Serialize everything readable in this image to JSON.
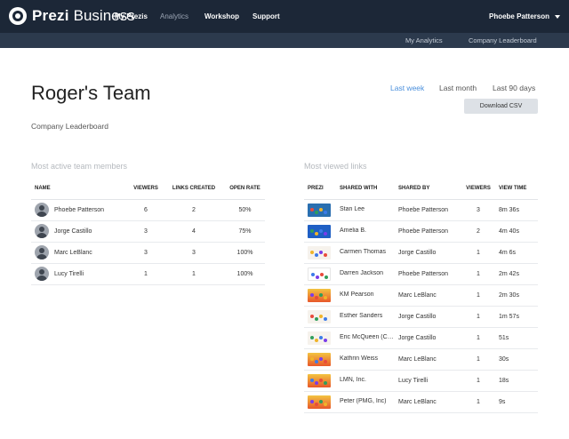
{
  "brand": {
    "name": "Prezi",
    "suffix": "Business"
  },
  "nav": {
    "my_prezis": "My Prezis",
    "analytics": "Analytics",
    "workshop": "Workshop",
    "support": "Support",
    "user": "Phoebe Patterson"
  },
  "subnav": {
    "my_analytics": "My Analytics",
    "leaderboard": "Company Leaderboard"
  },
  "header": {
    "title": "Roger's Team",
    "subtitle": "Company Leaderboard",
    "ranges": [
      "Last week",
      "Last month",
      "Last 90 days"
    ],
    "download": "Download CSV"
  },
  "members": {
    "title": "Most active team members",
    "columns": [
      "NAME",
      "VIEWERS",
      "LINKS CREATED",
      "OPEN RATE"
    ],
    "rows": [
      {
        "name": "Phoebe Patterson",
        "viewers": "6",
        "links": "2",
        "rate": "50%"
      },
      {
        "name": "Jorge Castillo",
        "viewers": "3",
        "links": "4",
        "rate": "75%"
      },
      {
        "name": "Marc LeBlanc",
        "viewers": "3",
        "links": "3",
        "rate": "100%"
      },
      {
        "name": "Lucy Tirelli",
        "viewers": "1",
        "links": "1",
        "rate": "100%"
      }
    ]
  },
  "viewed": {
    "title": "Most viewed links",
    "columns": [
      "PREZI",
      "SHARED WITH",
      "SHARED BY",
      "VIEWERS",
      "VIEW TIME"
    ],
    "rows": [
      {
        "thumb": "thumb-a",
        "with": "Stan Lee",
        "by": "Phoebe Patterson",
        "viewers": "3",
        "time": "8m 36s"
      },
      {
        "thumb": "thumb-b",
        "with": "Amelia B.",
        "by": "Phoebe Patterson",
        "viewers": "2",
        "time": "4m 40s"
      },
      {
        "thumb": "thumb-c",
        "with": "Carmen Thomas",
        "by": "Jorge Castillo",
        "viewers": "1",
        "time": "4m 6s"
      },
      {
        "thumb": "thumb-d",
        "with": "Darren Jackson",
        "by": "Phoebe Patterson",
        "viewers": "1",
        "time": "2m 42s"
      },
      {
        "thumb": "thumb-e",
        "with": "KM Pearson",
        "by": "Marc LeBlanc",
        "viewers": "1",
        "time": "2m 30s"
      },
      {
        "thumb": "thumb-c",
        "with": "Esther Sanders",
        "by": "Jorge Castillo",
        "viewers": "1",
        "time": "1m 57s"
      },
      {
        "thumb": "thumb-c",
        "with": "Eric McQueen (CM...",
        "by": "Jorge Castillo",
        "viewers": "1",
        "time": "51s"
      },
      {
        "thumb": "thumb-e",
        "with": "Kathrin Weiss",
        "by": "Marc LeBlanc",
        "viewers": "1",
        "time": "30s"
      },
      {
        "thumb": "thumb-e",
        "with": "LMN, Inc.",
        "by": "Lucy Tirelli",
        "viewers": "1",
        "time": "18s"
      },
      {
        "thumb": "thumb-e",
        "with": "Peter (PMG, Inc)",
        "by": "Marc LeBlanc",
        "viewers": "1",
        "time": "9s"
      }
    ]
  },
  "colors": {
    "topbar": "#1c2737",
    "subbar": "#2c3a4d",
    "accent": "#4a8fdc"
  }
}
